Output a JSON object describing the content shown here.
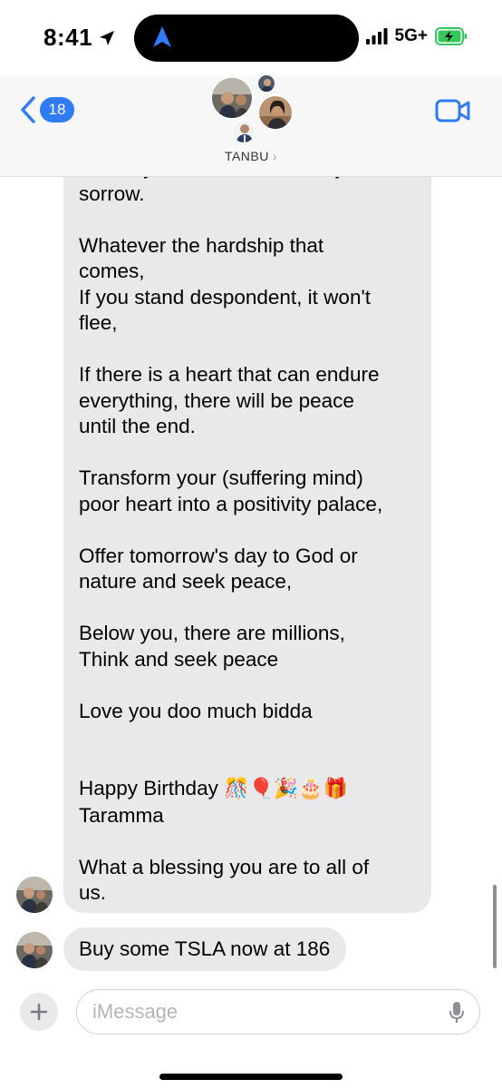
{
  "status_bar": {
    "time": "8:41",
    "network": "5G+",
    "icons": [
      "location-arrow-icon",
      "navigation-icon",
      "signal-bars-icon",
      "battery-charging-icon"
    ]
  },
  "header": {
    "back_badge": "18",
    "group_name": "TANBU",
    "chevron": "›",
    "icons": [
      "chevron-left-icon",
      "facetime-video-icon"
    ]
  },
  "messages": {
    "long_message": {
      "lines": [
        "At every threshold, there may be",
        "sorrow.",
        "",
        "Whatever the hardship that",
        "comes,",
        "If you stand despondent, it won't",
        "flee,",
        "",
        "If there is a heart that can endure",
        "everything, there will be peace",
        "until the end.",
        "",
        "Transform your (suffering mind)",
        "poor heart into a positivity palace,",
        "",
        "Offer tomorrow's day to God or",
        "nature and seek peace,",
        "",
        "Below you, there are millions,",
        "Think and seek peace",
        "",
        "Love you doo much bidda",
        "",
        "",
        "Happy Birthday",
        "Taramma",
        "",
        "What a blessing you are to all of",
        "us."
      ],
      "birthday_emojis": "🎊🎈🎉🎂🎁"
    },
    "short_message": "Buy some TSLA now at 186"
  },
  "compose": {
    "placeholder": "iMessage",
    "icons": [
      "plus-icon",
      "microphone-icon"
    ]
  },
  "colors": {
    "accent": "#2f7cf6",
    "bubble_gray": "#e9e9eb",
    "battery_green": "#34c759"
  }
}
